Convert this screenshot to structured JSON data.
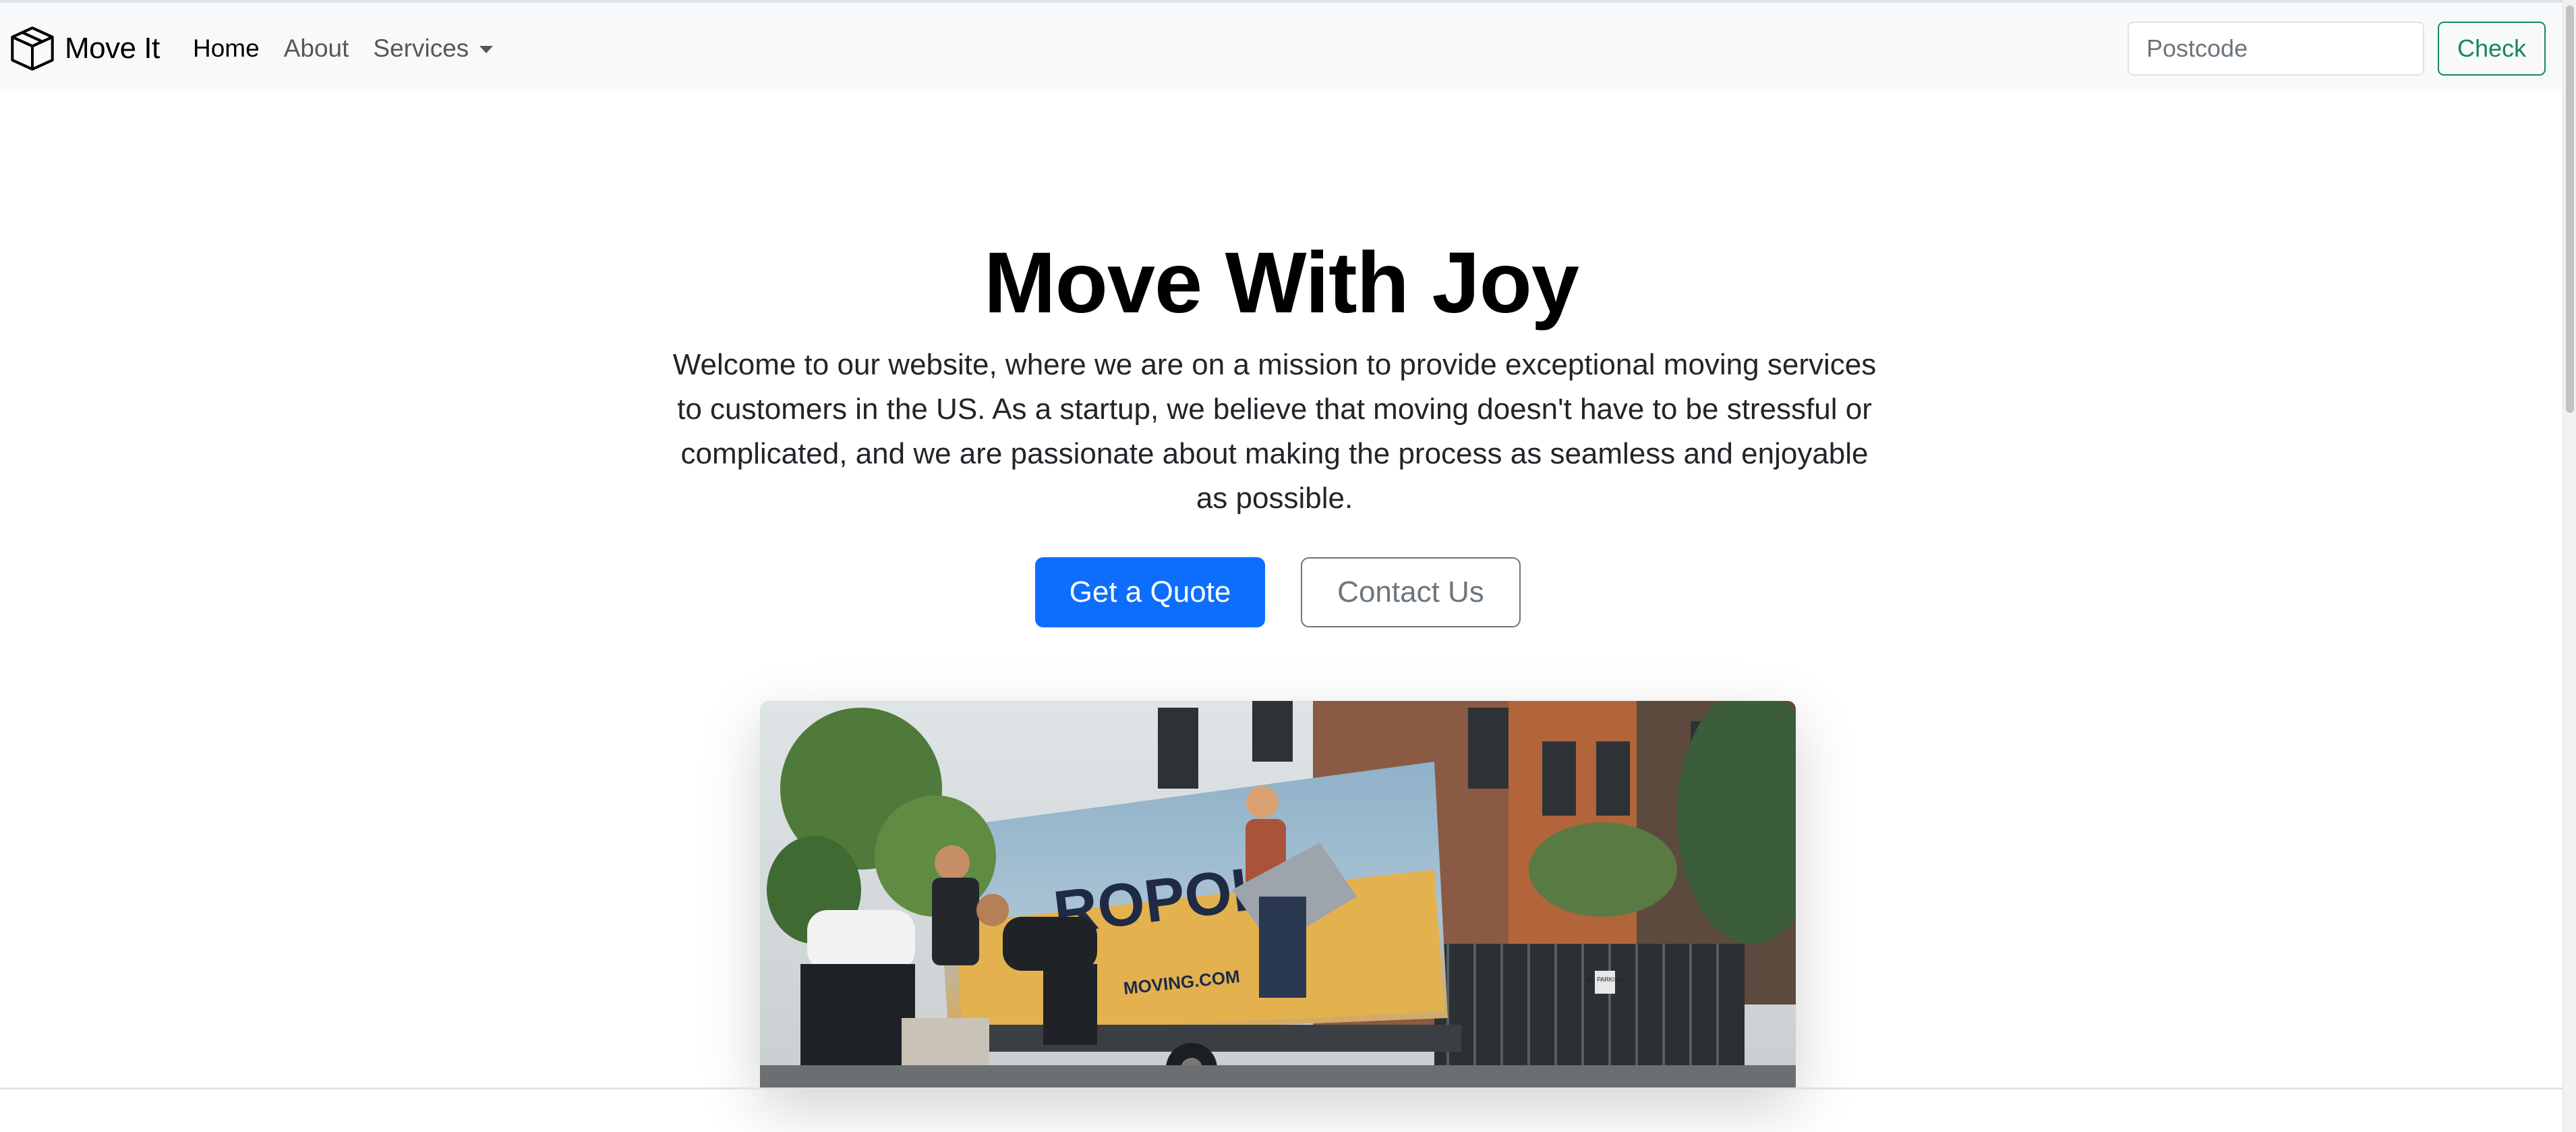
{
  "navbar": {
    "brand": "Move It",
    "brand_icon": "box-icon",
    "links": {
      "home": "Home",
      "about": "About",
      "services": "Services"
    },
    "search": {
      "placeholder": "Postcode",
      "value": ""
    },
    "check_label": "Check"
  },
  "hero": {
    "title": "Move With Joy",
    "text": "Welcome to our website, where we are on a mission to provide exceptional moving services to customers in the US. As a startup, we believe that moving doesn't have to be stressful or complicated, and we are passionate about making the process as seamless and enjoyable as possible.",
    "primary_button": "Get a Quote",
    "secondary_button": "Contact Us",
    "image": {
      "truck_text": "ROPOLIS",
      "truck_subtext": "MOVING.COM",
      "sign_text": "NO PARKING"
    }
  },
  "colors": {
    "primary": "#0d6efd",
    "success": "#198754",
    "secondary": "#6c757d",
    "navbar_bg": "#f8f9fa"
  }
}
